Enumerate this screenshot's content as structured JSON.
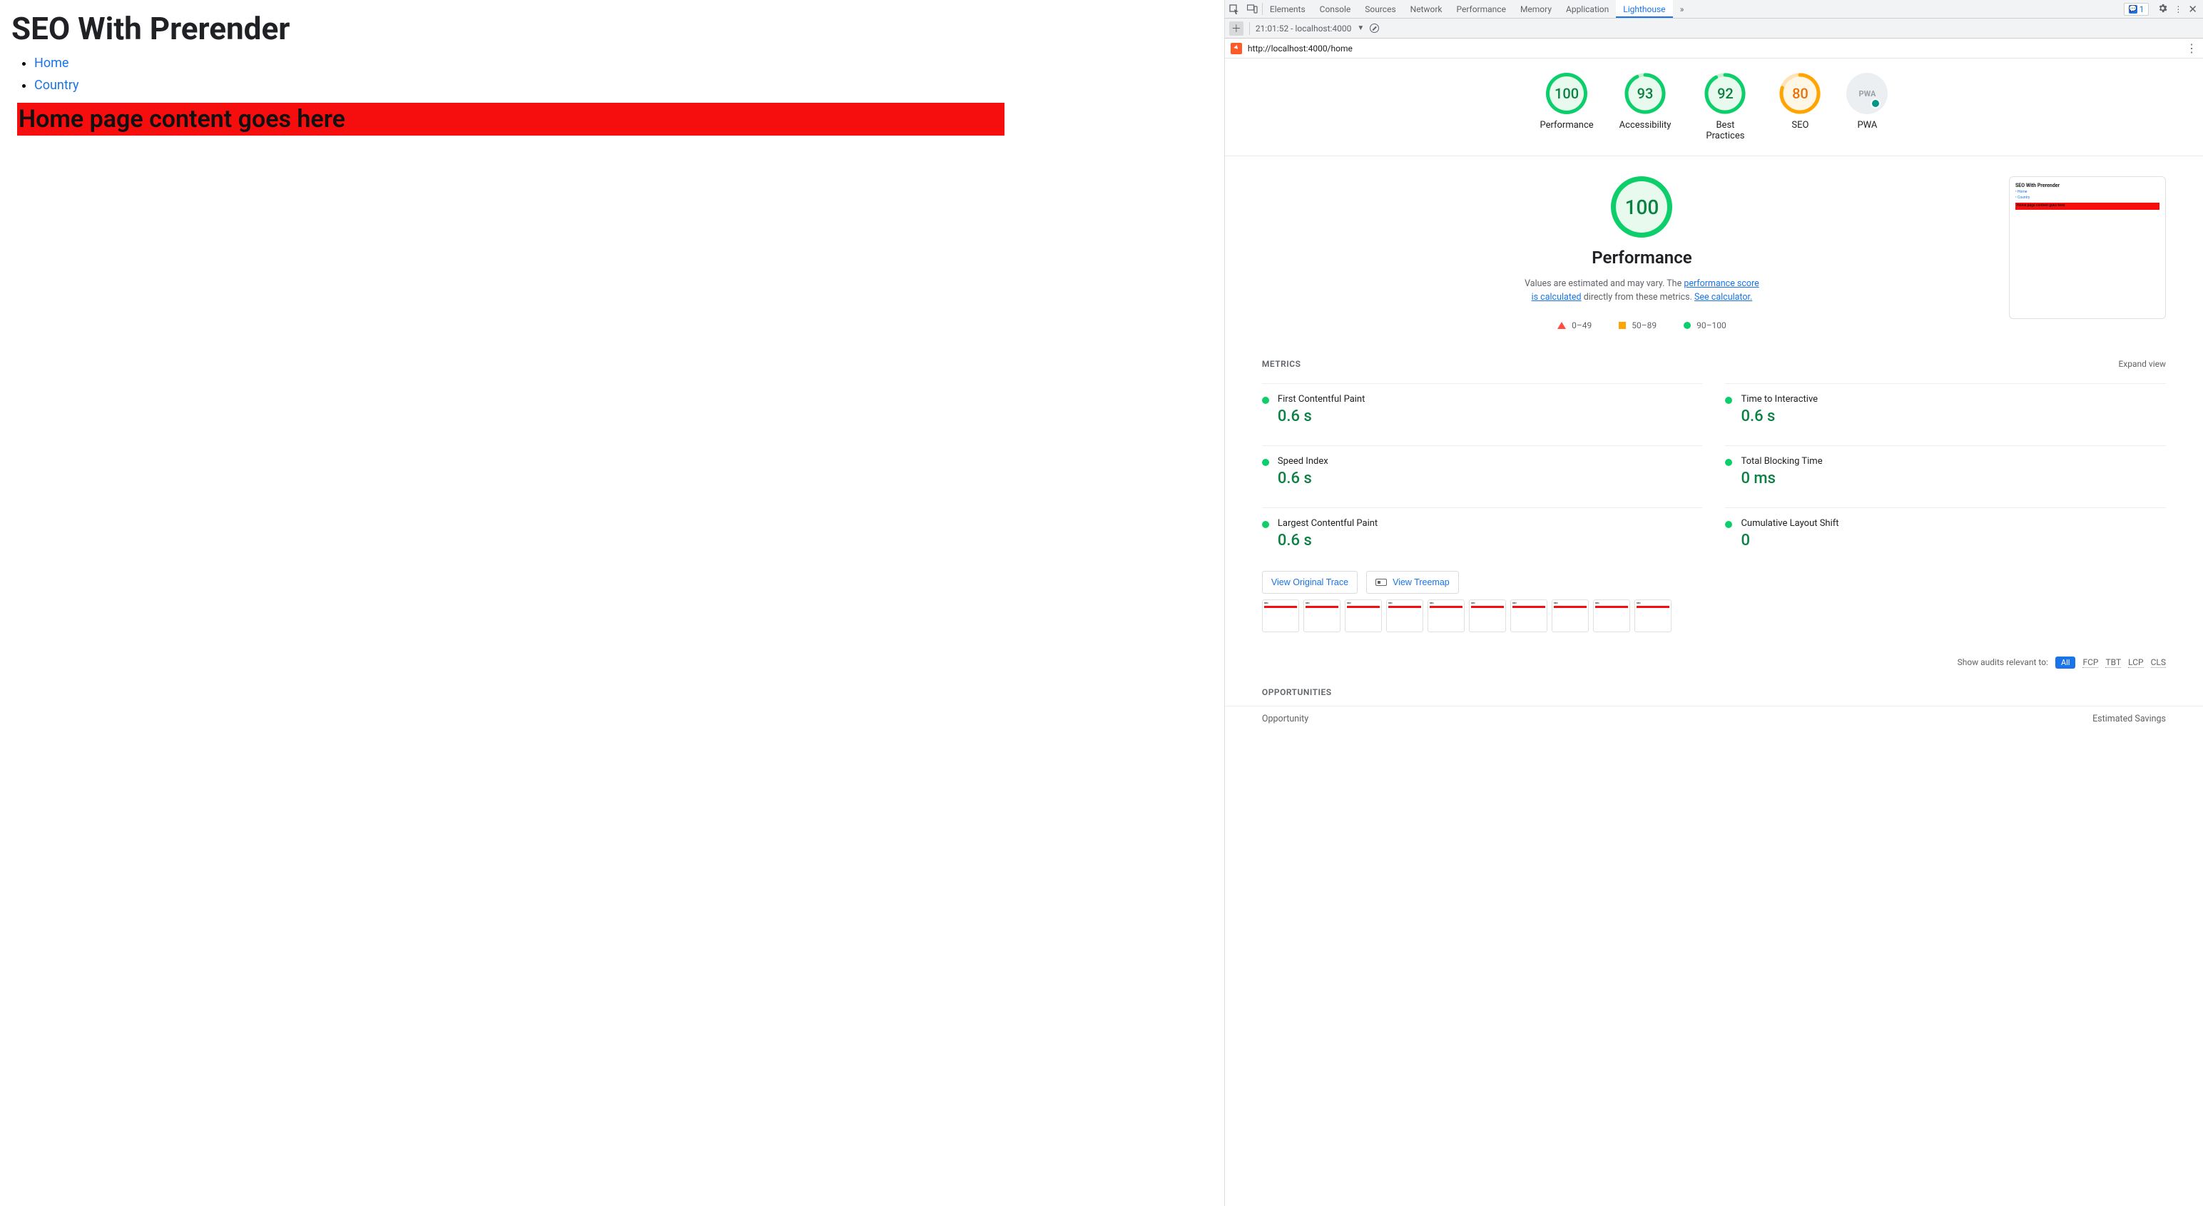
{
  "page": {
    "title": "SEO With Prerender",
    "nav": [
      {
        "label": "Home"
      },
      {
        "label": "Country"
      }
    ],
    "content_heading": "Home page content goes here"
  },
  "devtools": {
    "tabs": [
      "Elements",
      "Console",
      "Sources",
      "Network",
      "Performance",
      "Memory",
      "Application",
      "Lighthouse"
    ],
    "active_tab": "Lighthouse",
    "issues_count": "1",
    "subbar": {
      "timestamp": "21:01:52 - localhost:4000"
    },
    "url": "http://localhost:4000/home"
  },
  "lighthouse": {
    "gauges": [
      {
        "score": "100",
        "label": "Performance",
        "kind": "perf"
      },
      {
        "score": "93",
        "label": "Accessibility",
        "kind": "acc",
        "pct": 93
      },
      {
        "score": "92",
        "label": "Best Practices",
        "kind": "bp",
        "pct": 92
      },
      {
        "score": "80",
        "label": "SEO",
        "kind": "seo",
        "pct": 80
      },
      {
        "score": "PWA",
        "label": "PWA",
        "kind": "pwa"
      }
    ],
    "performance": {
      "score": "100",
      "heading": "Performance",
      "desc_prefix": "Values are estimated and may vary. The ",
      "desc_link1": "performance score is calculated",
      "desc_mid": " directly from these metrics. ",
      "desc_link2": "See calculator.",
      "legend": {
        "low": "0–49",
        "mid": "50–89",
        "high": "90–100"
      }
    },
    "metrics_title": "METRICS",
    "expand_label": "Expand view",
    "metrics": [
      {
        "name": "First Contentful Paint",
        "value": "0.6 s"
      },
      {
        "name": "Time to Interactive",
        "value": "0.6 s"
      },
      {
        "name": "Speed Index",
        "value": "0.6 s"
      },
      {
        "name": "Total Blocking Time",
        "value": "0 ms"
      },
      {
        "name": "Largest Contentful Paint",
        "value": "0.6 s"
      },
      {
        "name": "Cumulative Layout Shift",
        "value": "0"
      }
    ],
    "buttons": {
      "trace": "View Original Trace",
      "treemap": "View Treemap"
    },
    "filters": {
      "label": "Show audits relevant to:",
      "all": "All",
      "chips": [
        "FCP",
        "TBT",
        "LCP",
        "CLS"
      ]
    },
    "opportunities": {
      "title": "OPPORTUNITIES",
      "col1": "Opportunity",
      "col2": "Estimated Savings"
    },
    "mini": {
      "title": "SEO With Prerender",
      "li1": "Home",
      "li2": "Country",
      "bar": "Home page content goes here"
    }
  }
}
